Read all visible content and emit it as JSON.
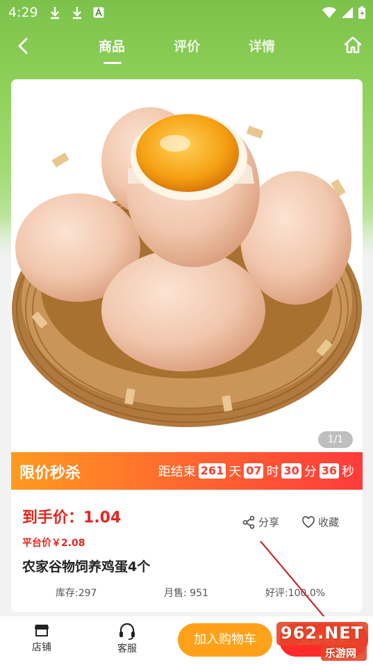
{
  "status_bar": {
    "time": "4:29"
  },
  "nav": {
    "tabs": [
      {
        "label": "商品",
        "active": true
      },
      {
        "label": "评价",
        "active": false
      },
      {
        "label": "详情",
        "active": false
      }
    ]
  },
  "product": {
    "image_counter": "1/1",
    "flash_sale": {
      "title": "限价秒杀",
      "ends_label": "距结束",
      "days": "261",
      "days_unit": "天",
      "hours": "07",
      "hours_unit": "时",
      "minutes": "30",
      "minutes_unit": "分",
      "seconds": "36",
      "seconds_unit": "秒"
    },
    "price_label": "到手价：",
    "price_value": "1.04",
    "platform_price": "平台价￥2.08",
    "share_label": "分享",
    "favorite_label": "收藏",
    "name": "农家谷物饲养鸡蛋4个",
    "stock": "库存:297",
    "monthly_sales": "月售: 951",
    "rating": "好评:100.0%"
  },
  "bottom_bar": {
    "store_label": "店铺",
    "service_label": "客服",
    "add_to_cart_label": "加入购物车",
    "buy_label": "立即购买"
  },
  "watermark": {
    "line1": "962.NET",
    "line2": "乐游网"
  },
  "colors": {
    "accent_red": "#e8241c",
    "cart_orange": "#ffa21a",
    "header_green": "#8fd15a"
  }
}
